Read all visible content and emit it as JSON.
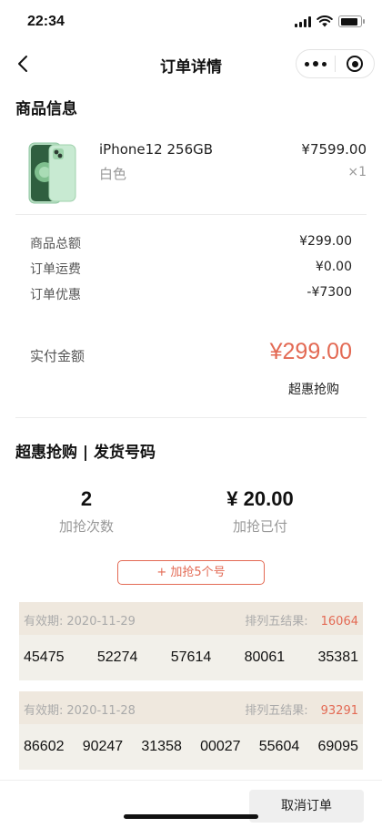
{
  "status_bar": {
    "time": "22:34",
    "battery_level": 0.9
  },
  "nav": {
    "title": "订单详情"
  },
  "goods_section": {
    "title": "商品信息",
    "product": {
      "name": "iPhone12 256GB",
      "spec": "白色",
      "price": "¥7599.00",
      "quantity": "×1"
    }
  },
  "fees": [
    {
      "label": "商品总额",
      "value": "¥299.00"
    },
    {
      "label": "订单运费",
      "value": "¥0.00"
    },
    {
      "label": "订单优惠",
      "value": "-¥7300"
    }
  ],
  "payment": {
    "label": "实付金额",
    "amount": "¥299.00",
    "tag": "超惠抢购"
  },
  "lottery_section": {
    "title": "超惠抢购 | 发货号码",
    "stats": [
      {
        "value": "2",
        "label": "加抢次数"
      },
      {
        "value": "¥ 20.00",
        "label": "加抢已付"
      }
    ],
    "add_button": "+ 加抢5个号",
    "tickets": [
      {
        "valid_label": "有效期:",
        "valid_date": "2020-11-29",
        "result_label": "排列五结果:",
        "result_value": "16064",
        "numbers": [
          "45475",
          "52274",
          "57614",
          "80061",
          "35381"
        ]
      },
      {
        "valid_label": "有效期:",
        "valid_date": "2020-11-28",
        "result_label": "排列五结果:",
        "result_value": "93291",
        "numbers": [
          "86602",
          "90247",
          "31358",
          "00027",
          "55604",
          "69095"
        ]
      }
    ]
  },
  "bottom": {
    "cancel_label": "取消订单"
  },
  "colors": {
    "accent": "#e36a54",
    "ticket_bg": "#f2f0ea",
    "ticket_header": "#efe8de"
  }
}
